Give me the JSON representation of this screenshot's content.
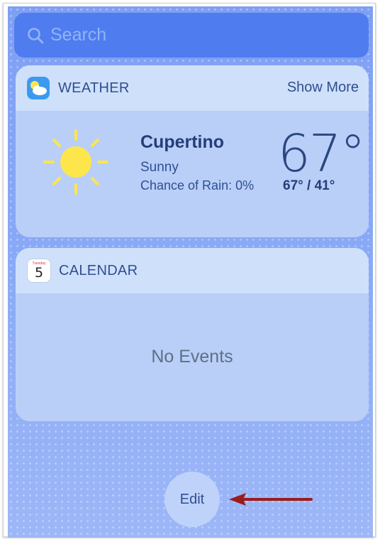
{
  "search": {
    "placeholder": "Search",
    "icon": "search-icon"
  },
  "weather": {
    "title": "WEATHER",
    "show_more": "Show More",
    "city": "Cupertino",
    "condition": "Sunny",
    "rain": "Chance of Rain: 0%",
    "temperature": "67°",
    "hilo": "67° / 41°",
    "icon": "weather-app-icon",
    "condition_icon": "sun-icon"
  },
  "calendar": {
    "title": "CALENDAR",
    "icon_day": "5",
    "icon_weekday": "Tuesday",
    "empty_text": "No Events"
  },
  "edit": {
    "label": "Edit"
  },
  "colors": {
    "background": "#86a6f4",
    "search_bg": "#4f7df0",
    "widget_header": "#cfe0fb",
    "widget_body": "#b9cff8",
    "text_primary": "#2f4f8f",
    "annotation_arrow": "#9b1c1c",
    "sun": "#fde64b"
  }
}
